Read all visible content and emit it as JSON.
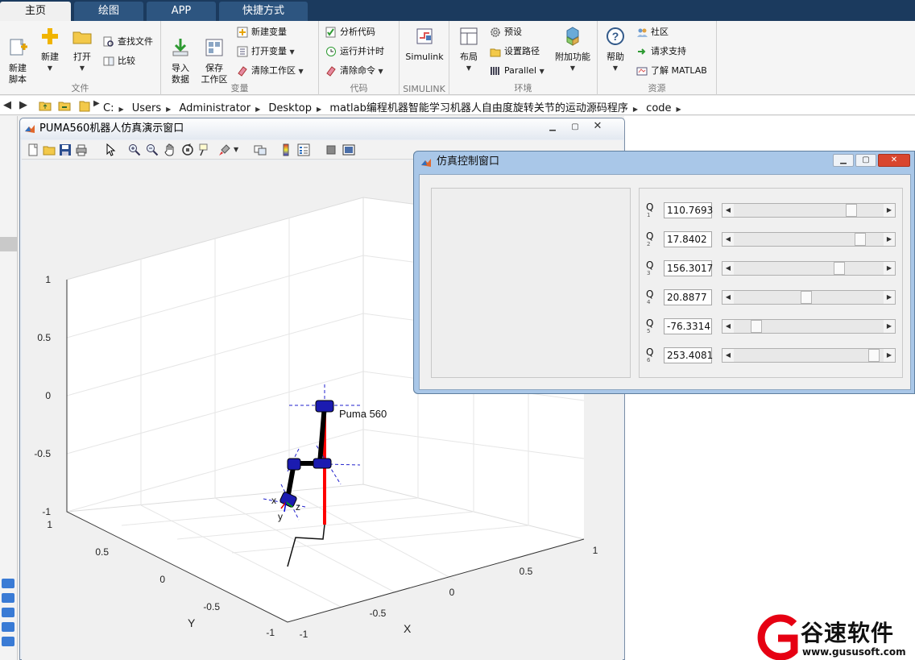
{
  "tabs": [
    {
      "label": "主页",
      "active": true
    },
    {
      "label": "绘图",
      "active": false
    },
    {
      "label": "APP",
      "active": false
    },
    {
      "label": "快捷方式",
      "active": false
    }
  ],
  "ribbon": {
    "file": {
      "title": "文件",
      "new_script": "新建\n脚本",
      "new": "新建",
      "open": "打开",
      "find_files": "查找文件",
      "compare": "比较"
    },
    "variable": {
      "title": "变量",
      "import_data": "导入\n数据",
      "save_workspace": "保存\n工作区",
      "new_variable": "新建变量",
      "open_variable": "打开变量",
      "clear_workspace": "清除工作区"
    },
    "code": {
      "title": "代码",
      "analyze_code": "分析代码",
      "run_and_time": "运行并计时",
      "clear_commands": "清除命令"
    },
    "simulink": {
      "title": "SIMULINK",
      "simulink": "Simulink"
    },
    "environment": {
      "title": "环境",
      "layout": "布局",
      "preferences": "预设",
      "set_path": "设置路径",
      "parallel": "Parallel",
      "addons": "附加功能"
    },
    "resources": {
      "title": "资源",
      "help": "帮助",
      "community": "社区",
      "request_support": "请求支持",
      "learn_matlab": "了解 MATLAB"
    }
  },
  "address": {
    "path": [
      "C:",
      "Users",
      "Administrator",
      "Desktop",
      "matlab编程机器智能学习机器人自由度旋转关节的运动源码程序",
      "code"
    ]
  },
  "figure": {
    "title": "PUMA560机器人仿真演示窗口",
    "robot_label": "Puma 560",
    "axes": {
      "z_ticks": [
        "1",
        "0.5",
        "0",
        "-0.5",
        "-1"
      ],
      "y_ticks": [
        "1",
        "0.5",
        "0",
        "-0.5",
        "-1"
      ],
      "x_ticks": [
        "-1",
        "-0.5",
        "0",
        "0.5",
        "1"
      ],
      "x_label": "X",
      "y_label": "Y",
      "frame_labels": [
        "x",
        "z",
        "y"
      ]
    }
  },
  "control": {
    "title": "仿真控制窗口",
    "joints": [
      {
        "label": "Q",
        "sub": "1",
        "value": "110.7693",
        "fraction": 0.81
      },
      {
        "label": "Q",
        "sub": "2",
        "value": "17.8402",
        "fraction": 0.87
      },
      {
        "label": "Q",
        "sub": "3",
        "value": "156.3017",
        "fraction": 0.72
      },
      {
        "label": "Q",
        "sub": "4",
        "value": "20.8877",
        "fraction": 0.48
      },
      {
        "label": "Q",
        "sub": "5",
        "value": "-76.3314",
        "fraction": 0.12
      },
      {
        "label": "Q",
        "sub": "6",
        "value": "253.4081",
        "fraction": 0.97
      }
    ]
  },
  "watermark": {
    "name": "谷速软件",
    "url": "www.gususoft.com"
  }
}
